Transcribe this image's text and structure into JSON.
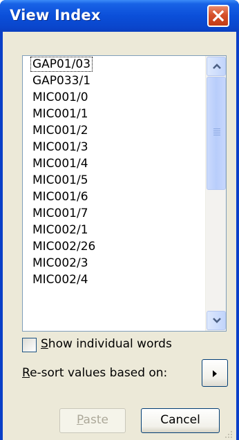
{
  "window": {
    "title": "View Index",
    "close_icon": "close-icon"
  },
  "index_list": {
    "items": [
      "GAP01/03",
      "GAP033/1",
      "MIC001/0",
      "MIC001/1",
      "MIC001/2",
      "MIC001/3",
      "MIC001/4",
      "MIC001/5",
      "MIC001/6",
      "MIC001/7",
      "MIC002/1",
      "MIC002/26",
      "MIC002/3",
      "MIC002/4"
    ],
    "focused_item": "GAP01/03",
    "scroll_position": 0.0
  },
  "options": {
    "show_words": {
      "label_accel": "S",
      "label_rest": "how individual words",
      "checked": false
    },
    "resort": {
      "label_accel": "R",
      "label_rest": "e-sort values based on:"
    }
  },
  "buttons": {
    "paste_accel": "P",
    "paste_rest": "aste",
    "paste_enabled": false,
    "cancel": "Cancel"
  },
  "colors": {
    "titlebar": "#0b4fd9",
    "close_button": "#d6502a",
    "dialog_background": "#ece9d8",
    "scrollbar_thumb": "#c1d4fb",
    "disabled_text": "#aca899"
  }
}
